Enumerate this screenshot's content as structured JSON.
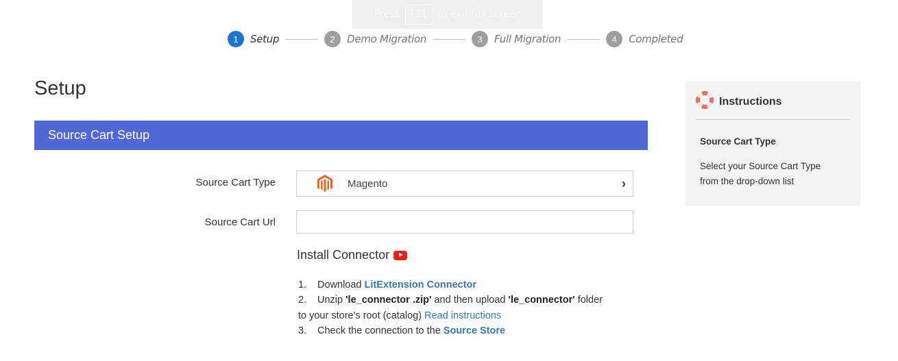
{
  "fullscreen_notice": {
    "prefix": "Press",
    "key": "F11",
    "suffix": "to exit full screen"
  },
  "stepper": {
    "steps": [
      {
        "number": "1",
        "label": "Setup",
        "active": true
      },
      {
        "number": "2",
        "label": "Demo Migration",
        "active": false
      },
      {
        "number": "3",
        "label": "Full Migration",
        "active": false
      },
      {
        "number": "4",
        "label": "Completed",
        "active": false
      }
    ]
  },
  "page": {
    "title": "Setup"
  },
  "section": {
    "title": "Source Cart Setup"
  },
  "form": {
    "source_cart_type": {
      "label": "Source Cart Type",
      "value": "Magento",
      "icon": "magento-logo-icon"
    },
    "source_cart_url": {
      "label": "Source Cart Url",
      "value": "",
      "placeholder": ""
    }
  },
  "install_connector": {
    "title": "Install Connector",
    "icon": "youtube-icon",
    "steps": {
      "s1": {
        "num": "1.",
        "text": "Download ",
        "link": "LitExtension Connector"
      },
      "s2": {
        "num": "2.",
        "text1": "Unzip ",
        "bold1": "'le_connector .zip'",
        "text2": " and then upload ",
        "bold2": "'le_connector'",
        "text3": " folder",
        "line2": "to your store's root (catalog) ",
        "link": "Read instructions"
      },
      "s3": {
        "num": "3.",
        "text": "Check the connection to the ",
        "link": "Source Store"
      }
    }
  },
  "instructions": {
    "title": "Instructions",
    "icon": "lifebuoy-icon",
    "subtitle": "Source Cart Type",
    "description": "Select your Source Cart Type from the drop-down list"
  },
  "colors": {
    "accent_blue": "#5068d6",
    "active_step": "#1976d2",
    "link": "#337ab7",
    "youtube": "#e62117",
    "magento": "#f26322"
  }
}
